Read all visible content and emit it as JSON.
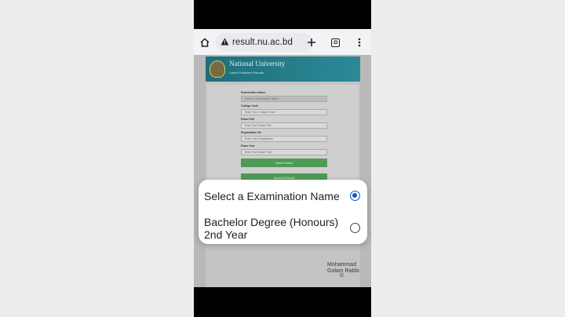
{
  "browser": {
    "url": "result.nu.ac.bd",
    "tabs_count": ":D"
  },
  "site": {
    "title": "National University",
    "subtitle": "Latest Published Results"
  },
  "form": {
    "fields": [
      {
        "label": "Examination Name",
        "value": "Select a Examination Name"
      },
      {
        "label": "College Code",
        "value": "Enter Your College Code"
      },
      {
        "label": "Exam Roll",
        "value": "Enter Your Exam Roll"
      },
      {
        "label": "Registration No",
        "value": "Enter Your Registration"
      },
      {
        "label": "Exam Year",
        "value": "Enter Your Exam Year"
      }
    ],
    "buttons": [
      "Search Result",
      "Search All Result"
    ]
  },
  "dialog": {
    "options": [
      {
        "label": "Select a Examination Name",
        "selected": true
      },
      {
        "label": "Bachelor Degree (Honours) 2nd Year",
        "selected": false
      }
    ]
  },
  "watermark": {
    "line1": "Mohammad",
    "line2": "Golam Rabbi",
    "symbol": "©"
  }
}
